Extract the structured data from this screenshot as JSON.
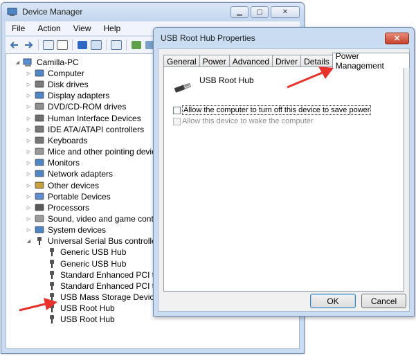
{
  "device_manager": {
    "title": "Device Manager",
    "caption": {
      "minimize": "▁",
      "maximize": "▢",
      "close": "✕"
    },
    "menu": [
      "File",
      "Action",
      "View",
      "Help"
    ],
    "tree": {
      "root": "Camilla-PC",
      "categories": [
        "Computer",
        "Disk drives",
        "Display adapters",
        "DVD/CD-ROM drives",
        "Human Interface Devices",
        "IDE ATA/ATAPI controllers",
        "Keyboards",
        "Mice and other pointing devices",
        "Monitors",
        "Network adapters",
        "Other devices",
        "Portable Devices",
        "Processors",
        "Sound, video and game controllers",
        "System devices",
        "Universal Serial Bus controllers"
      ],
      "usb_children": [
        "Generic USB Hub",
        "Generic USB Hub",
        "Standard Enhanced PCI to USB Host Controller",
        "Standard Enhanced PCI to USB Host Controller",
        "USB Mass Storage Device",
        "USB Root Hub",
        "USB Root Hub"
      ]
    }
  },
  "properties_dialog": {
    "title": "USB Root Hub Properties",
    "close": "✕",
    "tabs": [
      "General",
      "Power",
      "Advanced",
      "Driver",
      "Details",
      "Power Management"
    ],
    "active_tab": "Power Management",
    "device_name": "USB Root Hub",
    "options": [
      {
        "label": "Allow the computer to turn off this device to save power",
        "checked": false,
        "enabled": true
      },
      {
        "label": "Allow this device to wake the computer",
        "checked": false,
        "enabled": false
      }
    ],
    "ok_label": "OK",
    "cancel_label": "Cancel"
  },
  "colors": {
    "annotation_arrow": "#e8322b",
    "window_frame": "#c9dcf2",
    "focus_button": "#3c7fb1"
  },
  "icons": [
    "usb-plug-icon",
    "computer-icon",
    "monitor-icon",
    "processor-icon",
    "keyboard-icon",
    "mouse-icon"
  ]
}
